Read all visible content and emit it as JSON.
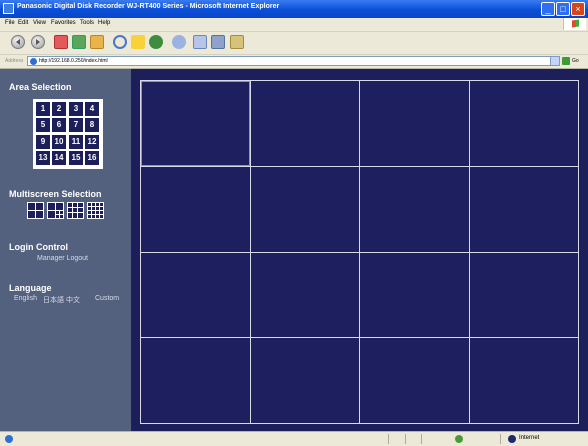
{
  "window": {
    "title": "Panasonic Digital Disk Recorder WJ-RT400 Series - Microsoft Internet Explorer",
    "buttons": [
      "_",
      "□",
      "×"
    ]
  },
  "menu": [
    "File",
    "Edit",
    "View",
    "Favorites",
    "Tools",
    "Help"
  ],
  "toolbar_icons": [
    "back-icon",
    "forward-icon",
    "stop-icon",
    "refresh-icon",
    "home-icon",
    "search-icon",
    "favorites-icon",
    "media-icon",
    "mail-icon",
    "print-icon",
    "edit-icon",
    "messenger-icon"
  ],
  "address": {
    "label": "Address",
    "url": "http://192.168.0.250/index.html",
    "go_label": "Go"
  },
  "sidebar": {
    "area_selection": {
      "title": "Area Selection",
      "cells": [
        "1",
        "2",
        "3",
        "4",
        "5",
        "6",
        "7",
        "8",
        "9",
        "10",
        "11",
        "12",
        "13",
        "14",
        "15",
        "16"
      ]
    },
    "multiscreen_selection": {
      "title": "Multiscreen Selection",
      "layouts": [
        "quad-layout-icon",
        "7-split-layout-icon",
        "9-split-layout-icon",
        "16-split-layout-icon"
      ]
    },
    "login_control": {
      "title": "Login Control",
      "status": "Manager Logout"
    },
    "language": {
      "title": "Language",
      "options": [
        "English",
        "日本語",
        "中文",
        "Custom"
      ]
    }
  },
  "main": {
    "layout": "16-split",
    "rows": 4,
    "columns": 4,
    "selected_area": 1
  },
  "status": {
    "zone": "Internet"
  },
  "colors": {
    "titlebar": "#0a4fd6",
    "sidebar": "#53617f",
    "grid_background": "#1e1f5e",
    "grid_lines": "#d8dbe6",
    "selected_border": "#42d04a"
  }
}
